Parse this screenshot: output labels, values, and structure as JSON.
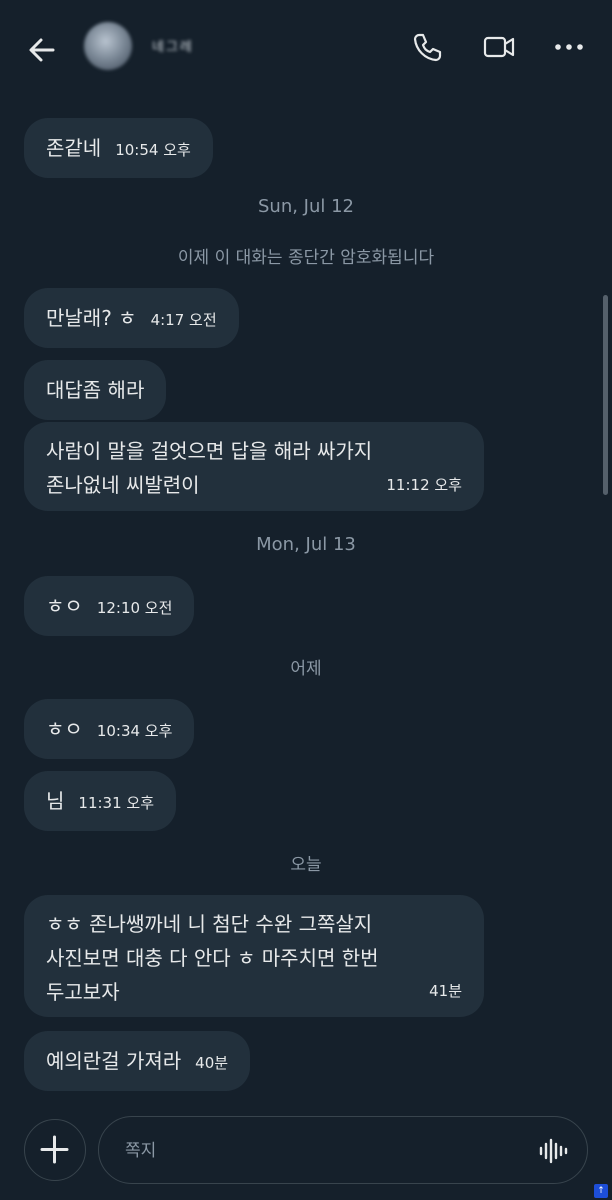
{
  "header": {
    "contact_name": "네그레",
    "icons": {
      "back": "arrow-left-icon",
      "call": "phone-icon",
      "video": "video-camera-icon",
      "more": "more-horizontal-icon"
    }
  },
  "messages": [
    {
      "text": "존같네",
      "time": "10:54 오후"
    },
    {
      "text": "만날래? ㅎ",
      "time": "4:17 오전"
    },
    {
      "text": "대답좀 해라",
      "time": ""
    },
    {
      "lines": [
        "사람이 말을 걸엇으면 답을 해라 싸가지",
        "존나없네 씨발련이"
      ],
      "time": "11:12 오후"
    },
    {
      "text": "ㅎㅇ",
      "time": "12:10 오전"
    },
    {
      "text": "ㅎㅇ",
      "time": "10:34 오후"
    },
    {
      "text": "님",
      "time": "11:31 오후"
    },
    {
      "lines": [
        "ㅎㅎ 존나쌩까네 니 첨단 수완 그쪽살지",
        "사진보면 대충 다 안다 ㅎ 마주치면 한번",
        "두고보자"
      ],
      "time": "41분"
    },
    {
      "text": "예의란걸 가져라",
      "time": "40분"
    }
  ],
  "separators": {
    "date_jul12": "Sun, Jul 12",
    "encryption_notice": "이제 이 대화는 종단간 암호화됩니다",
    "date_jul13": "Mon, Jul 13",
    "yesterday": "어제",
    "today": "오늘"
  },
  "composer": {
    "placeholder": "쪽지",
    "icons": {
      "add": "plus-icon",
      "voice": "voice-waveform-icon"
    }
  },
  "colors": {
    "background": "#15202b",
    "bubble": "#22303c",
    "text": "#e7e9ea",
    "muted": "#8b98a5",
    "border": "#38444d"
  }
}
